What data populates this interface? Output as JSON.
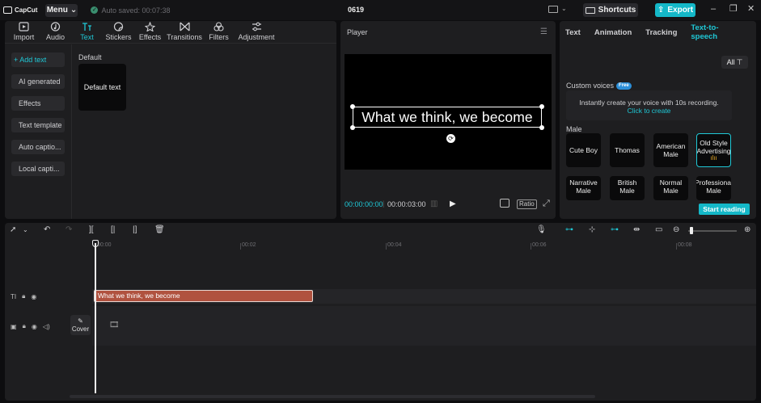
{
  "topbar": {
    "app_name": "CapCut",
    "menu_label": "Menu",
    "autosave_text": "Auto saved: 00:07:38",
    "project_name": "0619",
    "shortcuts_label": "Shortcuts",
    "export_label": "Export"
  },
  "media_toolbar": [
    {
      "label": "Import",
      "icon": "import-icon"
    },
    {
      "label": "Audio",
      "icon": "audio-icon"
    },
    {
      "label": "Text",
      "icon": "text-icon",
      "active": true
    },
    {
      "label": "Stickers",
      "icon": "stickers-icon"
    },
    {
      "label": "Effects",
      "icon": "effects-icon"
    },
    {
      "label": "Transitions",
      "icon": "transitions-icon"
    },
    {
      "label": "Filters",
      "icon": "filters-icon"
    },
    {
      "label": "Adjustment",
      "icon": "adjustment-icon"
    }
  ],
  "text_sidebar": [
    {
      "label": "+ Add text",
      "active": true
    },
    {
      "label": "AI generated"
    },
    {
      "label": "Effects"
    },
    {
      "label": "Text template"
    },
    {
      "label": "Auto captio..."
    },
    {
      "label": "Local capti..."
    }
  ],
  "text_library": {
    "section": "Default",
    "card_label": "Default text"
  },
  "player": {
    "title": "Player",
    "caption": "What we think, we become",
    "current_time": "00:00:00:00",
    "total_time": "00:00:03:00",
    "ratio_label": "Ratio"
  },
  "properties": {
    "tabs": [
      {
        "label": "Text"
      },
      {
        "label": "Animation"
      },
      {
        "label": "Tracking"
      },
      {
        "label": "Text-to-speech",
        "active": true
      }
    ],
    "filter_label": "All",
    "custom_voices_label": "Custom voices",
    "free_badge": "Free",
    "custom_card_text": "Instantly create your voice with 10s recording.",
    "custom_card_link": "Click to create",
    "male_label": "Male",
    "voices": [
      {
        "label": "Cute Boy"
      },
      {
        "label": "Thomas"
      },
      {
        "label": "American Male"
      },
      {
        "label": "Old Style Advertising",
        "active": true
      },
      {
        "label": "Narrative Male"
      },
      {
        "label": "British Male"
      },
      {
        "label": "Normal Male"
      },
      {
        "label": "Professional Male"
      }
    ],
    "start_reading_label": "Start reading"
  },
  "timeline": {
    "ruler_labels": [
      "00:00",
      "00:02",
      "00:04",
      "00:06",
      "00:08"
    ],
    "text_clip_label": "What we think, we become",
    "cover_label": "Cover"
  },
  "colors": {
    "accent": "#1fc8d6",
    "export": "#14b8c8",
    "text_clip": "#b0523f",
    "panel": "#1e1e20",
    "background": "#0d0d0f"
  }
}
